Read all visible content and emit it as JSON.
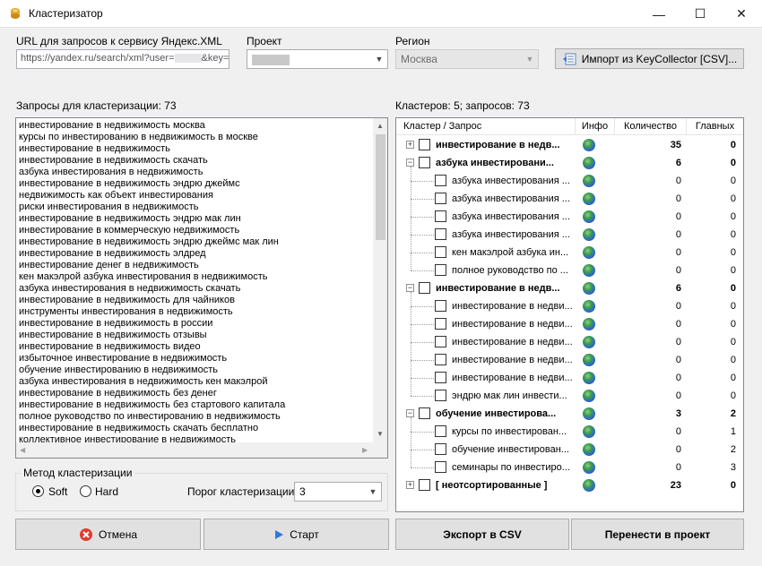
{
  "window": {
    "title": "Кластеризатор",
    "controls": {
      "minimize": "—",
      "maximize": "☐",
      "close": "✕"
    }
  },
  "fields": {
    "url_label": "URL для запросов к сервису Яндекс.XML",
    "url_value": "https://yandex.ru/search/xml?user=",
    "url_value_tail": "&key=",
    "project_label": "Проект",
    "region_label": "Регион",
    "region_value": "Москва",
    "import_button": "Импорт из KeyCollector [CSV]..."
  },
  "queries": {
    "label": "Запросы для кластеризации: 73",
    "items": [
      "инвестирование в недвижимость москва",
      "курсы по инвестированию в недвижимость в москве",
      "инвестирование в недвижимость",
      "инвестирование в недвижимость скачать",
      "азбука инвестирования в недвижимость",
      "инвестирование в недвижимость эндрю джеймс",
      "недвижимость как объект инвестирования",
      "риски инвестирования в недвижимость",
      "инвестирование в недвижимость эндрю мак лин",
      "инвестирование в коммерческую недвижимость",
      "инвестирование в недвижимость эндрю джеймс мак лин",
      "инвестирование в недвижимость элдред",
      "инвестирование денег в недвижимость",
      "кен макэлрой азбука инвестирования в недвижимость",
      "азбука инвестирования в недвижимость скачать",
      "инвестирование в недвижимость для чайников",
      "инструменты инвестирования в недвижимость",
      "инвестирование в недвижимость в россии",
      "инвестирование в недвижимость отзывы",
      "инвестирование в недвижимость видео",
      "избыточное инвестирование в недвижимость",
      "обучение инвестированию в недвижимость",
      "азбука инвестирования в недвижимость кен макэлрой",
      "инвестирование в недвижимость без денег",
      "инвестирование в недвижимость без стартового капитала",
      "полное руководство по инвестированию в недвижимость",
      "инвестирование в недвижимость скачать бесплатно",
      "коллективное инвестирование в недвижимость"
    ]
  },
  "clusters": {
    "label": "Кластеров: 5; запросов: 73",
    "columns": [
      "Кластер / Запрос",
      "Инфо",
      "Количество",
      "Главных"
    ],
    "rows": [
      {
        "level": 0,
        "expander": "+",
        "name": "инвестирование в недв...",
        "count": "35",
        "main": "0"
      },
      {
        "level": 0,
        "expander": "−",
        "name": "азбука инвестировани...",
        "count": "6",
        "main": "0"
      },
      {
        "level": 1,
        "name": "азбука инвестирования ...",
        "count": "0",
        "main": "0"
      },
      {
        "level": 1,
        "name": "азбука инвестирования ...",
        "count": "0",
        "main": "0"
      },
      {
        "level": 1,
        "name": "азбука инвестирования ...",
        "count": "0",
        "main": "0"
      },
      {
        "level": 1,
        "name": "азбука инвестирования ...",
        "count": "0",
        "main": "0"
      },
      {
        "level": 1,
        "name": "кен макэлрой азбука ин...",
        "count": "0",
        "main": "0"
      },
      {
        "level": 1,
        "name": "полное руководство по ...",
        "count": "0",
        "main": "0"
      },
      {
        "level": 0,
        "expander": "−",
        "name": "инвестирование в недв...",
        "count": "6",
        "main": "0"
      },
      {
        "level": 1,
        "name": "инвестирование в недви...",
        "count": "0",
        "main": "0"
      },
      {
        "level": 1,
        "name": "инвестирование в недви...",
        "count": "0",
        "main": "0"
      },
      {
        "level": 1,
        "name": "инвестирование в недви...",
        "count": "0",
        "main": "0"
      },
      {
        "level": 1,
        "name": "инвестирование в недви...",
        "count": "0",
        "main": "0"
      },
      {
        "level": 1,
        "name": "инвестирование в недви...",
        "count": "0",
        "main": "0"
      },
      {
        "level": 1,
        "name": "эндрю мак лин инвести...",
        "count": "0",
        "main": "0"
      },
      {
        "level": 0,
        "expander": "−",
        "name": "обучение инвестирова...",
        "count": "3",
        "main": "2"
      },
      {
        "level": 1,
        "name": "курсы по инвестирован...",
        "count": "0",
        "main": "1"
      },
      {
        "level": 1,
        "name": "обучение инвестирован...",
        "count": "0",
        "main": "2"
      },
      {
        "level": 1,
        "name": "семинары по инвестиро...",
        "count": "0",
        "main": "3"
      },
      {
        "level": 0,
        "expander": "+",
        "name": "[ неотсортированные ]",
        "count": "23",
        "main": "0"
      }
    ]
  },
  "method": {
    "group_label": "Метод кластеризации",
    "soft": "Soft",
    "hard": "Hard",
    "selected": "Soft",
    "threshold_label": "Порог кластеризации",
    "threshold_value": "3"
  },
  "buttons": {
    "cancel": "Отмена",
    "start": "Старт",
    "export": "Экспорт в CSV",
    "move": "Перенести в проект"
  },
  "colors": {
    "accent_blue": "#0078d7",
    "cancel_red": "#e23b2e"
  }
}
